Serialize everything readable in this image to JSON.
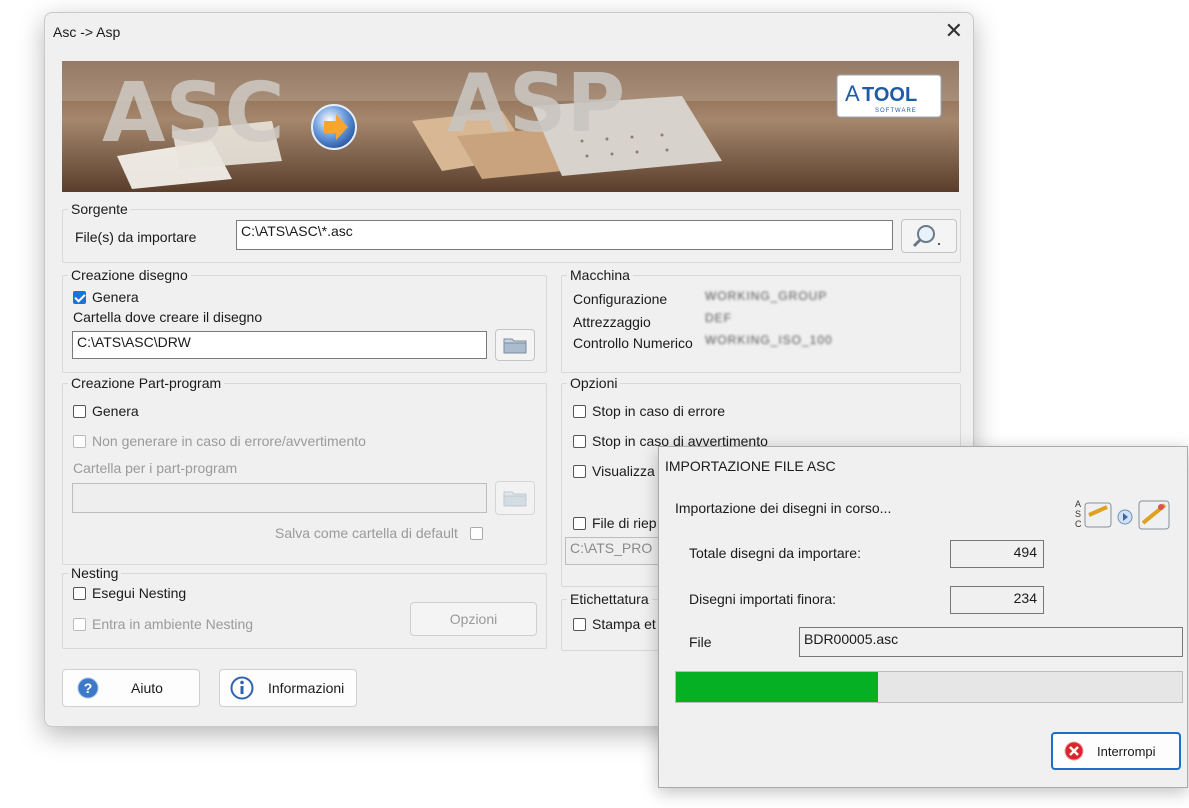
{
  "window": {
    "title": "Asc -> Asp",
    "close_glyph": "✕"
  },
  "banner": {
    "word_left": "ASC",
    "word_right": "ASP",
    "logo_text": "TOOL",
    "logo_letter": "A",
    "logo_sub": "SOFTWARE"
  },
  "sorgente": {
    "legend": "Sorgente",
    "files_label": "File(s) da importare",
    "files_value": "C:\\ATS\\ASC\\*.asc",
    "browse_icon": "search-icon"
  },
  "creazione_disegno": {
    "legend": "Creazione disegno",
    "genera_label": "Genera",
    "genera_checked": true,
    "folder_label": "Cartella dove creare il disegno",
    "folder_value": "C:\\ATS\\ASC\\DRW",
    "folder_icon": "folder-icon"
  },
  "macchina": {
    "legend": "Macchina",
    "config_label": "Configurazione",
    "config_value": "WORKING_GROUP",
    "attrezzaggio_label": "Attrezzaggio",
    "attrezzaggio_value": "DEF",
    "cn_label": "Controllo Numerico",
    "cn_value": "WORKING_ISO_100"
  },
  "creazione_pp": {
    "legend": "Creazione Part-program",
    "genera_label": "Genera",
    "genera_checked": false,
    "non_generare_label": "Non generare in caso di errore/avvertimento",
    "folder_label": "Cartella per i part-program",
    "folder_value": "",
    "save_default_label": "Salva come cartella di default"
  },
  "opzioni": {
    "legend": "Opzioni",
    "stop_errore_label": "Stop in caso di errore",
    "stop_avvertimento_label": "Stop in caso di avvertimento",
    "visualizza_label": "Visualizza",
    "file_riep_label": "File di riep",
    "file_riep_value": "C:\\ATS_PRO"
  },
  "nesting": {
    "legend": "Nesting",
    "esegui_label": "Esegui Nesting",
    "entra_label": "Entra in ambiente Nesting",
    "opzioni_button": "Opzioni"
  },
  "etichettatura": {
    "legend": "Etichettatura",
    "stampa_label": "Stampa et"
  },
  "footer": {
    "aiuto_label": "Aiuto",
    "info_label": "Informazioni"
  },
  "progress_dialog": {
    "title": "IMPORTAZIONE FILE ASC",
    "status": "Importazione dei disegni in corso...",
    "totale_label": "Totale disegni da importare:",
    "totale_value": "494",
    "importati_label": "Disegni importati finora:",
    "importati_value": "234",
    "file_label": "File",
    "file_value": "BDR00005.asc",
    "progress_fraction": 0.4,
    "progress_color": "#06b025",
    "icon_letters": "ASC",
    "interrompi_label": "Interrompi"
  }
}
